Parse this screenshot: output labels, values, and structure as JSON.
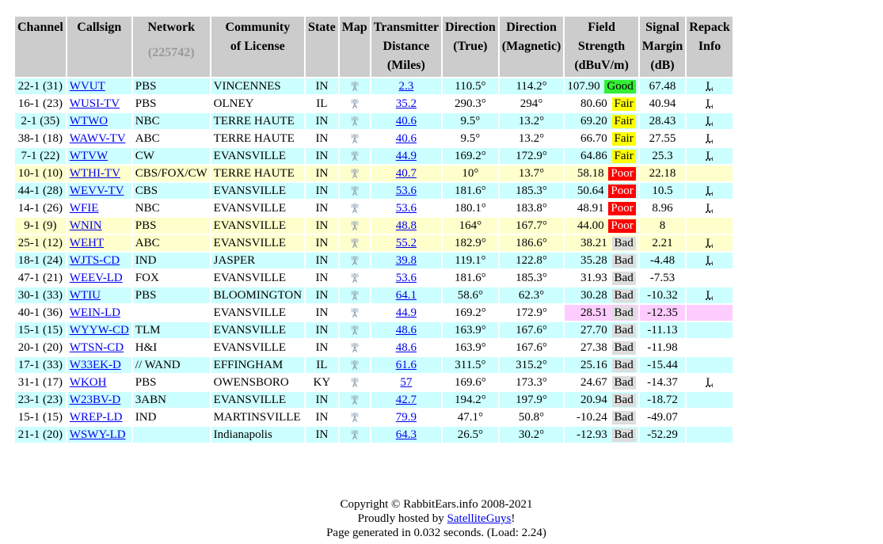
{
  "headers": {
    "channel": "Channel",
    "callsign": "Callsign",
    "network": "Network",
    "network_count": "(225742)",
    "community_l1": "Community",
    "community_l2": "of License",
    "state": "State",
    "map": "Map",
    "distance_l1": "Transmitter",
    "distance_l2": "Distance",
    "distance_l3": "(Miles)",
    "dir_true_l1": "Direction",
    "dir_true_l2": "(True)",
    "dir_mag_l1": "Direction",
    "dir_mag_l2": "(Magnetic)",
    "field_l1": "Field",
    "field_l2": "Strength",
    "field_l3": "(dBuV/m)",
    "margin_l1": "Signal",
    "margin_l2": "Margin",
    "margin_l3": "(dB)",
    "repack_l1": "Repack",
    "repack_l2": "Info"
  },
  "rows": [
    {
      "channel": "22-1 (31)",
      "callsign": "WVUT",
      "network": "PBS",
      "community": "VINCENNES",
      "state": "IN",
      "distance": "2.3",
      "dir_true": "110.5°",
      "dir_mag": "114.2°",
      "field": "107.90",
      "rating": "Good",
      "margin": "67.48",
      "repack": "L",
      "row_color": "cyan",
      "pink": false
    },
    {
      "channel": "16-1 (23)",
      "callsign": "WUSI-TV",
      "network": "PBS",
      "community": "OLNEY",
      "state": "IL",
      "distance": "35.2",
      "dir_true": "290.3°",
      "dir_mag": "294°",
      "field": "80.60",
      "rating": "Fair",
      "margin": "40.94",
      "repack": "L",
      "row_color": "white",
      "pink": false
    },
    {
      "channel": "2-1 (35)",
      "callsign": "WTWO",
      "network": "NBC",
      "community": "TERRE HAUTE",
      "state": "IN",
      "distance": "40.6",
      "dir_true": "9.5°",
      "dir_mag": "13.2°",
      "field": "69.20",
      "rating": "Fair",
      "margin": "28.43",
      "repack": "L",
      "row_color": "cyan",
      "pink": false
    },
    {
      "channel": "38-1 (18)",
      "callsign": "WAWV-TV",
      "network": "ABC",
      "community": "TERRE HAUTE",
      "state": "IN",
      "distance": "40.6",
      "dir_true": "9.5°",
      "dir_mag": "13.2°",
      "field": "66.70",
      "rating": "Fair",
      "margin": "27.55",
      "repack": "L",
      "row_color": "white",
      "pink": false
    },
    {
      "channel": "7-1 (22)",
      "callsign": "WTVW",
      "network": "CW",
      "community": "EVANSVILLE",
      "state": "IN",
      "distance": "44.9",
      "dir_true": "169.2°",
      "dir_mag": "172.9°",
      "field": "64.86",
      "rating": "Fair",
      "margin": "25.3",
      "repack": "L",
      "row_color": "cyan",
      "pink": false
    },
    {
      "channel": "10-1 (10)",
      "callsign": "WTHI-TV",
      "network": "CBS/FOX/CW",
      "community": "TERRE HAUTE",
      "state": "IN",
      "distance": "40.7",
      "dir_true": "10°",
      "dir_mag": "13.7°",
      "field": "58.18",
      "rating": "Poor",
      "margin": "22.18",
      "repack": "",
      "row_color": "yellow",
      "pink": false
    },
    {
      "channel": "44-1 (28)",
      "callsign": "WEVV-TV",
      "network": "CBS",
      "community": "EVANSVILLE",
      "state": "IN",
      "distance": "53.6",
      "dir_true": "181.6°",
      "dir_mag": "185.3°",
      "field": "50.64",
      "rating": "Poor",
      "margin": "10.5",
      "repack": "L",
      "row_color": "cyan",
      "pink": false
    },
    {
      "channel": "14-1 (26)",
      "callsign": "WFIE",
      "network": "NBC",
      "community": "EVANSVILLE",
      "state": "IN",
      "distance": "53.6",
      "dir_true": "180.1°",
      "dir_mag": "183.8°",
      "field": "48.91",
      "rating": "Poor",
      "margin": "8.96",
      "repack": "L",
      "row_color": "white",
      "pink": false
    },
    {
      "channel": "9-1 (9)",
      "callsign": "WNIN",
      "network": "PBS",
      "community": "EVANSVILLE",
      "state": "IN",
      "distance": "48.8",
      "dir_true": "164°",
      "dir_mag": "167.7°",
      "field": "44.00",
      "rating": "Poor",
      "margin": "8",
      "repack": "",
      "row_color": "yellow",
      "pink": false
    },
    {
      "channel": "25-1 (12)",
      "callsign": "WEHT",
      "network": "ABC",
      "community": "EVANSVILLE",
      "state": "IN",
      "distance": "55.2",
      "dir_true": "182.9°",
      "dir_mag": "186.6°",
      "field": "38.21",
      "rating": "Bad",
      "margin": "2.21",
      "repack": "L",
      "row_color": "yellow",
      "pink": false
    },
    {
      "channel": "18-1 (24)",
      "callsign": "WJTS-CD",
      "network": "IND",
      "community": "JASPER",
      "state": "IN",
      "distance": "39.8",
      "dir_true": "119.1°",
      "dir_mag": "122.8°",
      "field": "35.28",
      "rating": "Bad",
      "margin": "-4.48",
      "repack": "L",
      "row_color": "cyan",
      "pink": false
    },
    {
      "channel": "47-1 (21)",
      "callsign": "WEEV-LD",
      "network": "FOX",
      "community": "EVANSVILLE",
      "state": "IN",
      "distance": "53.6",
      "dir_true": "181.6°",
      "dir_mag": "185.3°",
      "field": "31.93",
      "rating": "Bad",
      "margin": "-7.53",
      "repack": "",
      "row_color": "white",
      "pink": false
    },
    {
      "channel": "30-1 (33)",
      "callsign": "WTIU",
      "network": "PBS",
      "community": "BLOOMINGTON",
      "state": "IN",
      "distance": "64.1",
      "dir_true": "58.6°",
      "dir_mag": "62.3°",
      "field": "30.28",
      "rating": "Bad",
      "margin": "-10.32",
      "repack": "L",
      "row_color": "cyan",
      "pink": false
    },
    {
      "channel": "40-1 (36)",
      "callsign": "WEIN-LD",
      "network": "",
      "community": "EVANSVILLE",
      "state": "IN",
      "distance": "44.9",
      "dir_true": "169.2°",
      "dir_mag": "172.9°",
      "field": "28.51",
      "rating": "Bad",
      "margin": "-12.35",
      "repack": "",
      "row_color": "white",
      "pink": true
    },
    {
      "channel": "15-1 (15)",
      "callsign": "WYYW-CD",
      "network": "TLM",
      "community": "EVANSVILLE",
      "state": "IN",
      "distance": "48.6",
      "dir_true": "163.9°",
      "dir_mag": "167.6°",
      "field": "27.70",
      "rating": "Bad",
      "margin": "-11.13",
      "repack": "",
      "row_color": "cyan",
      "pink": false
    },
    {
      "channel": "20-1 (20)",
      "callsign": "WTSN-CD",
      "network": "H&I",
      "community": "EVANSVILLE",
      "state": "IN",
      "distance": "48.6",
      "dir_true": "163.9°",
      "dir_mag": "167.6°",
      "field": "27.38",
      "rating": "Bad",
      "margin": "-11.98",
      "repack": "",
      "row_color": "white",
      "pink": false
    },
    {
      "channel": "17-1 (33)",
      "callsign": "W33EK-D",
      "network": "// WAND",
      "community": "EFFINGHAM",
      "state": "IL",
      "distance": "61.6",
      "dir_true": "311.5°",
      "dir_mag": "315.2°",
      "field": "25.16",
      "rating": "Bad",
      "margin": "-15.44",
      "repack": "",
      "row_color": "cyan",
      "pink": false
    },
    {
      "channel": "31-1 (17)",
      "callsign": "WKOH",
      "network": "PBS",
      "community": "OWENSBORO",
      "state": "KY",
      "distance": "57",
      "dir_true": "169.6°",
      "dir_mag": "173.3°",
      "field": "24.67",
      "rating": "Bad",
      "margin": "-14.37",
      "repack": "L",
      "row_color": "white",
      "pink": false
    },
    {
      "channel": "23-1 (23)",
      "callsign": "W23BV-D",
      "network": "3ABN",
      "community": "EVANSVILLE",
      "state": "IN",
      "distance": "42.7",
      "dir_true": "194.2°",
      "dir_mag": "197.9°",
      "field": "20.94",
      "rating": "Bad",
      "margin": "-18.72",
      "repack": "",
      "row_color": "cyan",
      "pink": false
    },
    {
      "channel": "15-1 (15)",
      "callsign": "WREP-LD",
      "network": "IND",
      "community": "MARTINSVILLE",
      "state": "IN",
      "distance": "79.9",
      "dir_true": "47.1°",
      "dir_mag": "50.8°",
      "field": "-10.24",
      "rating": "Bad",
      "margin": "-49.07",
      "repack": "",
      "row_color": "white",
      "pink": false
    },
    {
      "channel": "21-1 (20)",
      "callsign": "WSWY-LD",
      "network": "",
      "community": "Indianapolis",
      "state": "IN",
      "distance": "64.3",
      "dir_true": "26.5°",
      "dir_mag": "30.2°",
      "field": "-12.93",
      "rating": "Bad",
      "margin": "-52.29",
      "repack": "",
      "row_color": "cyan",
      "pink": false
    }
  ],
  "footer": {
    "copyright": "Copyright © RabbitEars.info 2008-2021",
    "hosted_prefix": "Proudly hosted by ",
    "hosted_link": "SatelliteGuys",
    "hosted_suffix": "!",
    "generated": "Page generated in 0.032 seconds. (Load: 2.24)"
  },
  "colors": {
    "header_bg": "#cccccc",
    "row_cyan": "#ccffff",
    "row_yellow": "#ffffcc",
    "row_pink": "#ffccff",
    "good": "#33ee33",
    "fair": "#ffff00",
    "poor": "#ff0000",
    "bad": "#dddddd",
    "link": "#0000ee"
  },
  "icons": {
    "map": "antenna-map-icon"
  }
}
